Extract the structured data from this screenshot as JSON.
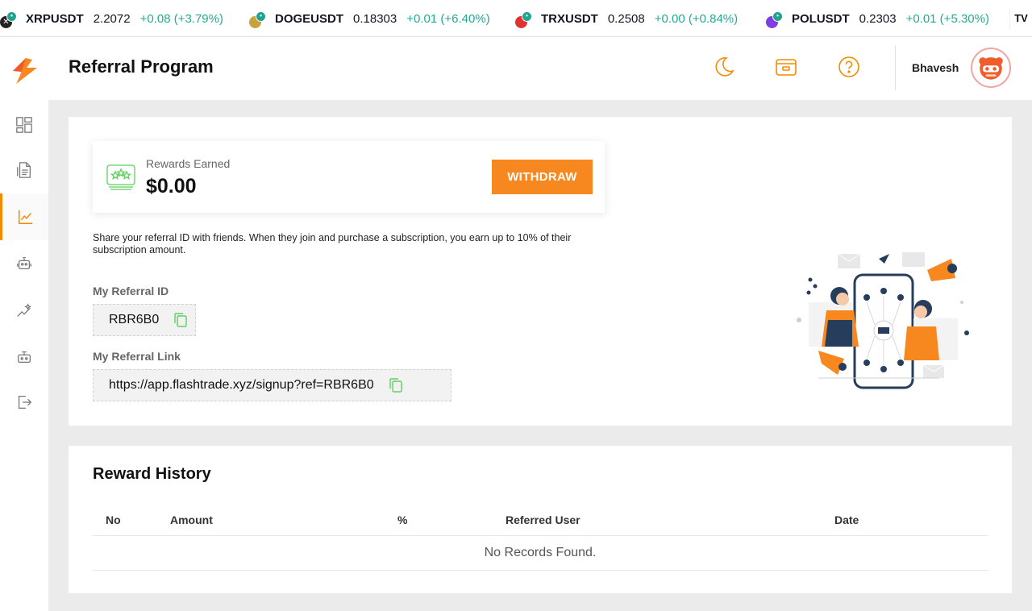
{
  "ticker": [
    {
      "symbol": "XRPUSDT",
      "price": "2.2072",
      "change": "+0.08 (+3.79%)",
      "color": "#222222"
    },
    {
      "symbol": "DOGEUSDT",
      "price": "0.18303",
      "change": "+0.01 (+6.40%)",
      "color": "#c8a23a"
    },
    {
      "symbol": "TRXUSDT",
      "price": "0.2508",
      "change": "+0.00 (+0.84%)",
      "color": "#e0322f"
    },
    {
      "symbol": "POLUSDT",
      "price": "0.2303",
      "change": "+0.01 (+5.30%)",
      "color": "#7b3fe4"
    }
  ],
  "ticker_brand": "TV",
  "header": {
    "title": "Referral Program",
    "username": "Bhavesh"
  },
  "rewards": {
    "label": "Rewards Earned",
    "value": "$0.00",
    "withdraw_label": "WITHDRAW"
  },
  "share_text": "Share your referral ID with friends. When they join and purchase a subscription, you earn up to 10% of their subscription amount.",
  "referral": {
    "id_label": "My Referral ID",
    "id_value": "RBR6B0",
    "link_label": "My Referral Link",
    "link_value": "https://app.flashtrade.xyz/signup?ref=RBR6B0"
  },
  "history": {
    "title": "Reward History",
    "columns": [
      "No",
      "Amount",
      "%",
      "Referred User",
      "Date"
    ],
    "empty_text": "No Records Found."
  },
  "colors": {
    "accent": "#f7881f",
    "positive": "#22ab94",
    "copy_icon": "#5fcf5f"
  }
}
